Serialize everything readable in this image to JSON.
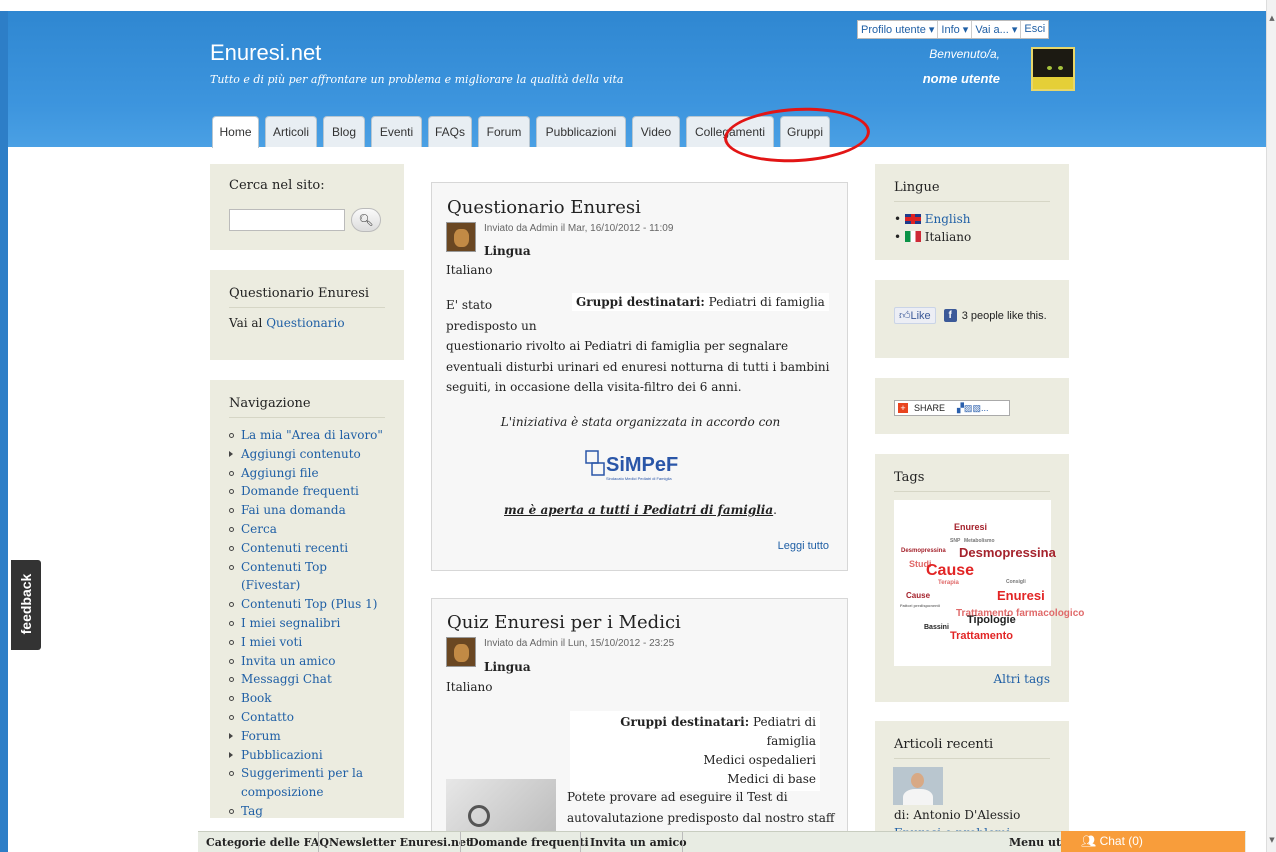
{
  "site": {
    "name": "Enuresi.net",
    "slogan": "Tutto e di più per affrontare un problema e migliorare la qualità della vita"
  },
  "user_menu": [
    "Profilo utente ▾",
    "Info ▾",
    "Vai a... ▾",
    "Esci"
  ],
  "welcome": "Benvenuto/a,",
  "username": "nome utente",
  "tabs": [
    "Home",
    "Articoli",
    "Blog",
    "Eventi",
    "FAQs",
    "Forum",
    "Pubblicazioni",
    "Video",
    "Collegamenti",
    "Gruppi"
  ],
  "active_tab": "Home",
  "sidebar_left": {
    "search_title": "Cerca nel sito:",
    "search_button_icon": "search-icon",
    "questionario_title": "Questionario Enuresi",
    "questionario_prefix": "Vai al",
    "questionario_link": "Questionario",
    "nav_title": "Navigazione",
    "nav_items": [
      "La mia \"Area di lavoro\"",
      "Aggiungi contenuto",
      "Aggiungi file",
      "Domande frequenti",
      "Fai una domanda",
      "Cerca",
      "Contenuti recenti",
      "Contenuti Top (Fivestar)",
      "Contenuti Top (Plus 1)",
      "I miei segnalibri",
      "I miei voti",
      "Invita un amico",
      "Messaggi Chat",
      "Book",
      "Contatto",
      "Forum",
      "Pubblicazioni",
      "Suggerimenti per la composizione",
      "Tag"
    ]
  },
  "articles": [
    {
      "title": "Questionario Enuresi",
      "meta": "Inviato da Admin il Mar, 16/10/2012 - 11:09",
      "lingua_label": "Lingua",
      "lingua": "Italiano",
      "gruppi_label": "Gruppi destinatari:",
      "gruppi": [
        "Pediatri di famiglia"
      ],
      "body_start": "E' stato predisposto un",
      "body": "questionario rivolto ai Pediatri di famiglia per segnalare eventuali disturbi urinari ed enuresi notturna di tutti i bambini seguiti, in occasione della visita-filtro dei 6 anni.",
      "iniziativa": "L'iniziativa è stata organizzata in accordo con",
      "logo_text": "SiMPeF",
      "logo_sub": "Sindacato Medici Pediatri di Famiglia",
      "aperta": "ma è aperta a tutti i Pediatri di famiglia",
      "readmore": "Leggi tutto"
    },
    {
      "title": "Quiz Enuresi per i Medici",
      "meta": "Inviato da Admin il Lun, 15/10/2012 - 23:25",
      "lingua_label": "Lingua",
      "lingua": "Italiano",
      "gruppi_label": "Gruppi destinatari:",
      "gruppi": [
        "Pediatri di famiglia",
        "Medici ospedalieri",
        "Medici di base"
      ],
      "body": "Potete provare ad eseguire il Test di autovalutazione predisposto dal nostro staff"
    }
  ],
  "sidebar_right": {
    "lingue_title": "Lingue",
    "languages": [
      "English",
      "Italiano"
    ],
    "like_label": "Like",
    "like_count": "3 people like this.",
    "share_label": "SHARE",
    "tags_title": "Tags",
    "tags": [
      "Enuresi",
      "SNP",
      "Metabolismo",
      "Desmopressina",
      "Desmopressina",
      "Studi",
      "Cause",
      "Terapia",
      "Consigli",
      "Cause",
      "Enuresi",
      "Fattori predisponenti",
      "Trattamento farmacologico",
      "Tipologie",
      "Bassini",
      "Trattamento"
    ],
    "altri_tags": "Altri tags",
    "recent_title": "Articoli recenti",
    "recent_author": "di: Antonio D'Alessio",
    "recent_link": "Enuresi e problemi"
  },
  "feedback": "feedback",
  "bottom_bar": [
    "Categorie delle FAQ",
    "Newsletter Enuresi.net",
    "Domande frequenti",
    "Invita un amico"
  ],
  "bottom_menu": "Menu ute",
  "chat": "Chat (0)"
}
